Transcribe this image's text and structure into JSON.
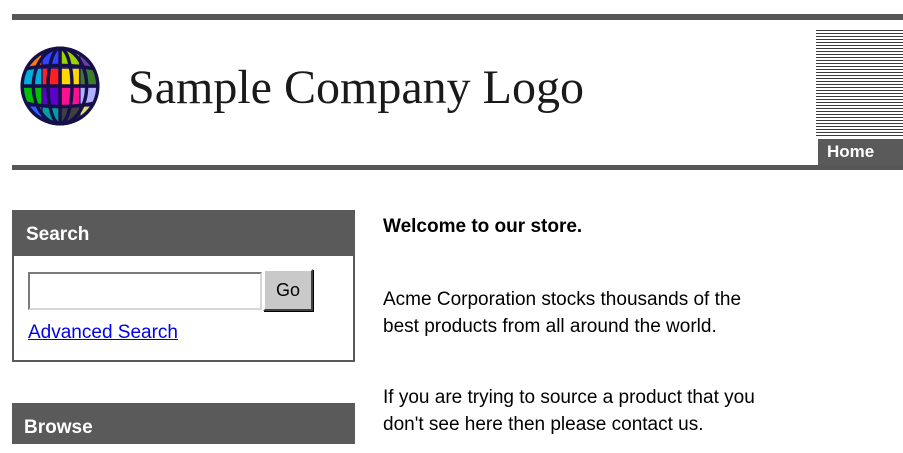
{
  "header": {
    "logo_text": "Sample Company Logo",
    "nav": {
      "home_label": "Home"
    }
  },
  "sidebar": {
    "search": {
      "title": "Search",
      "input_value": "",
      "go_label": "Go",
      "advanced_link": "Advanced Search"
    },
    "browse": {
      "title": "Browse"
    }
  },
  "main": {
    "welcome_heading": "Welcome to our store.",
    "paragraph1_line1": "Acme Corporation stocks thousands of the",
    "paragraph1_line2": "best products from all around the world.",
    "paragraph2_line1": "If you are trying to source a product that you",
    "paragraph2_line2": "don't see here then please contact us."
  },
  "colors": {
    "header_bar": "#5a5a5a",
    "rule": "#575757",
    "link": "#0000ee",
    "button_face": "#c9c9c9"
  },
  "icons": {
    "logo": "globe-icon"
  }
}
